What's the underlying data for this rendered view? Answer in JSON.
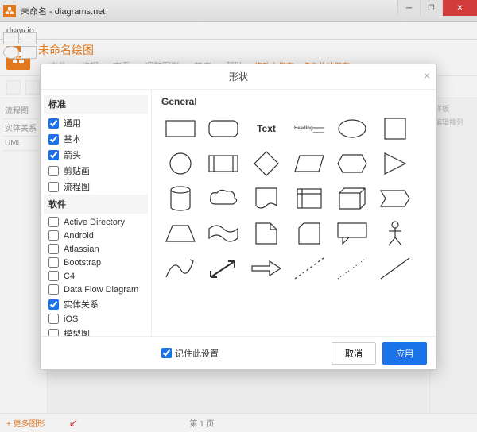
{
  "window": {
    "title": "未命名 - diagrams.net"
  },
  "urlbar": "draw.io",
  "header": {
    "doc_title": "未命名绘图",
    "menu": [
      "文件",
      "编辑",
      "查看",
      "调整图形",
      "其它",
      "帮助"
    ],
    "warn": "修改未保存。点击此处保存。"
  },
  "left_categories": [
    "流程图",
    "实体关系",
    "UML"
  ],
  "right_tabs": [
    "样板",
    "编辑排列"
  ],
  "footer": {
    "more": "+ 更多图形",
    "page": "第 1 页"
  },
  "dialog": {
    "title": "形状",
    "sections": {
      "standard": {
        "label": "标准",
        "items": [
          {
            "label": "通用",
            "checked": true
          },
          {
            "label": "基本",
            "checked": true
          },
          {
            "label": "箭头",
            "checked": true
          },
          {
            "label": "剪贴画",
            "checked": false
          },
          {
            "label": "流程图",
            "checked": false
          }
        ]
      },
      "software": {
        "label": "软件",
        "items": [
          {
            "label": "Active Directory",
            "checked": false
          },
          {
            "label": "Android",
            "checked": false
          },
          {
            "label": "Atlassian",
            "checked": false
          },
          {
            "label": "Bootstrap",
            "checked": false
          },
          {
            "label": "C4",
            "checked": false
          },
          {
            "label": "Data Flow Diagram",
            "checked": false
          },
          {
            "label": "实体关系",
            "checked": true
          },
          {
            "label": "iOS",
            "checked": false
          },
          {
            "label": "模型图",
            "checked": false
          }
        ]
      }
    },
    "preview_title": "General",
    "text_label": "Text",
    "heading_label": "Heading",
    "remember": "记住此设置",
    "cancel": "取消",
    "apply": "应用"
  }
}
